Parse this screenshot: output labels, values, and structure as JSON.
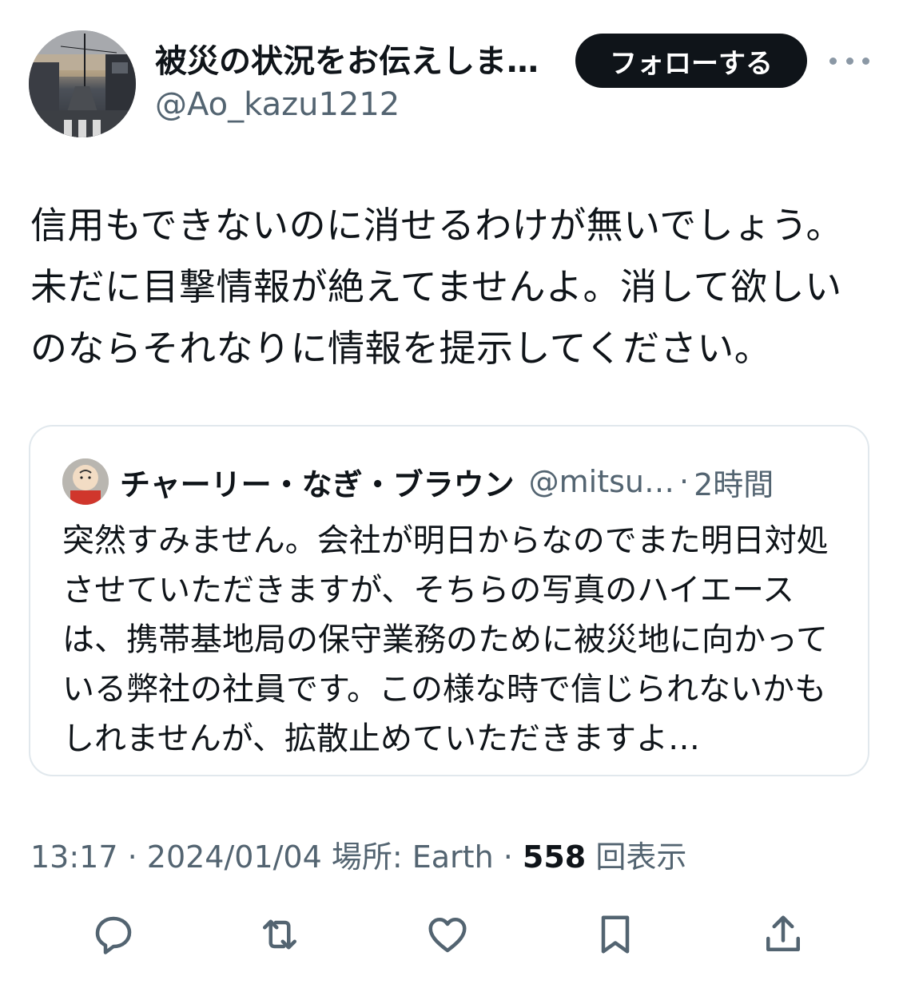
{
  "author": {
    "display_name": "被災の状況をお伝えしま…",
    "handle": "@Ao_kazu1212",
    "avatar_icon": "street-photo-avatar"
  },
  "header": {
    "follow_label": "フォローする",
    "more_icon": "more-horizontal-icon"
  },
  "tweet": {
    "text": "信用もできないのに消せるわけが無いでしょう。未だに目撃情報が絶えてませんよ。消して欲しいのならそれなりに情報を提示してください。"
  },
  "quote": {
    "display_name": "チャーリー・なぎ・ブラウン",
    "handle": "@mitsu…",
    "separator": "·",
    "time": "2時間",
    "text": "突然すみません。会社が明日からなのでまた明日対処させていただきますが、そちらの写真のハイエースは、携帯基地局の保守業務のために被災地に向かっている弊社の社員です。この様な時で信じられないかもしれませんが、拡散止めていただきますよ…"
  },
  "meta": {
    "time": "13:17",
    "sep1": " · ",
    "date": "2024/01/04",
    "location": " 場所: Earth",
    "sep2": " · ",
    "views_count": "558",
    "views_label": " 回表示"
  },
  "actions": [
    {
      "name": "reply",
      "icon": "reply-icon"
    },
    {
      "name": "repost",
      "icon": "repost-icon"
    },
    {
      "name": "like",
      "icon": "like-icon"
    },
    {
      "name": "bookmark",
      "icon": "bookmark-icon"
    },
    {
      "name": "share",
      "icon": "share-icon"
    }
  ],
  "colors": {
    "text_primary": "#0f1419",
    "text_secondary": "#536471",
    "border": "#e1e8ed",
    "follow_bg": "#0f1419"
  }
}
